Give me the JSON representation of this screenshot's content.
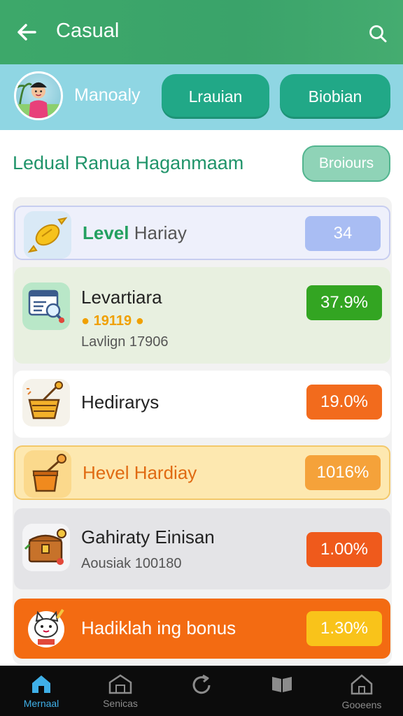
{
  "app": {
    "title": "Casual"
  },
  "profile": {
    "name": "Manoaly",
    "button1": "Lrauian",
    "button2": "Biobian"
  },
  "section": {
    "title": "Ledual Ranua Haganmaam",
    "button": "Broiours"
  },
  "cards": [
    {
      "label_prefix": "Level",
      "label": "Hariay",
      "badge": "34",
      "icon": "lemon-candy-icon"
    },
    {
      "label": "Levartiara",
      "sub1": "19119",
      "sub2": "Lavlign 17906",
      "badge": "37.9%",
      "icon": "magnifier-document-icon"
    },
    {
      "label": "Hedirarys",
      "badge": "19.0%",
      "icon": "basket-icon"
    },
    {
      "label": "Hevel Hardiay",
      "badge": "1016%",
      "icon": "bucket-icon"
    },
    {
      "label": "Gahiraty Einisan",
      "sub2": "Aousiak 100180",
      "badge": "1.00%",
      "icon": "treasure-chest-icon"
    },
    {
      "label": "Hadiklah ing bonus",
      "badge": "1.30%",
      "icon": "cat-mascot-icon"
    }
  ],
  "nav": [
    {
      "label": "Mernaal",
      "icon": "home-icon",
      "active": true
    },
    {
      "label": "Senicas",
      "icon": "shop-icon",
      "active": false
    },
    {
      "label": "",
      "icon": "refresh-icon",
      "active": false
    },
    {
      "label": "",
      "icon": "book-icon",
      "active": false
    },
    {
      "label": "Gooeens",
      "icon": "house-icon",
      "active": false
    }
  ],
  "colors": {
    "header": "#3da86a",
    "profile_bar": "#8fd6e3",
    "accent_button": "#21a887",
    "green_badge": "#33a522",
    "orange_badge": "#f26b1d"
  }
}
